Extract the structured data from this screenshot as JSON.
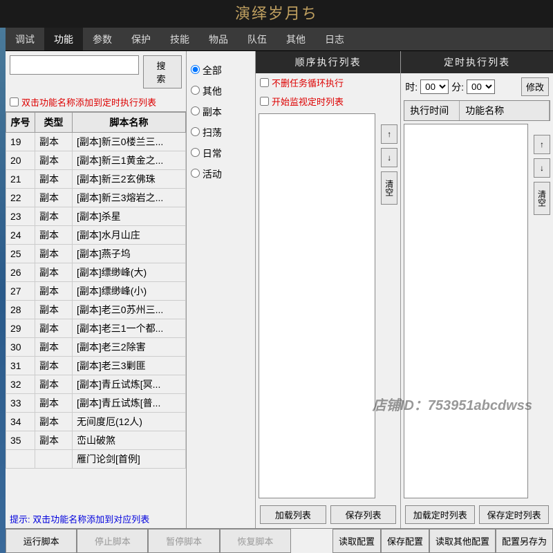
{
  "title": "演绎岁月ち",
  "menu": [
    "调试",
    "功能",
    "参数",
    "保护",
    "技能",
    "物品",
    "队伍",
    "其他",
    "日志"
  ],
  "menu_active": 1,
  "search_btn": "搜 索",
  "add_hint": "双击功能名称添加到定时执行列表",
  "table_headers": [
    "序号",
    "类型",
    "脚本名称"
  ],
  "scripts": [
    {
      "n": "19",
      "t": "副本",
      "name": "[副本]新三0楼兰三..."
    },
    {
      "n": "20",
      "t": "副本",
      "name": "[副本]新三1黄金之..."
    },
    {
      "n": "21",
      "t": "副本",
      "name": "[副本]新三2玄佛珠"
    },
    {
      "n": "22",
      "t": "副本",
      "name": "[副本]新三3熔岩之..."
    },
    {
      "n": "23",
      "t": "副本",
      "name": "[副本]杀星"
    },
    {
      "n": "24",
      "t": "副本",
      "name": "[副本]水月山庄"
    },
    {
      "n": "25",
      "t": "副本",
      "name": "[副本]燕子坞"
    },
    {
      "n": "26",
      "t": "副本",
      "name": "[副本]缥缈峰(大)"
    },
    {
      "n": "27",
      "t": "副本",
      "name": "[副本]缥缈峰(小)"
    },
    {
      "n": "28",
      "t": "副本",
      "name": "[副本]老三0苏州三..."
    },
    {
      "n": "29",
      "t": "副本",
      "name": "[副本]老三1一个都..."
    },
    {
      "n": "30",
      "t": "副本",
      "name": "[副本]老三2除害"
    },
    {
      "n": "31",
      "t": "副本",
      "name": "[副本]老三3剿匪"
    },
    {
      "n": "32",
      "t": "副本",
      "name": "[副本]青丘试炼[冥..."
    },
    {
      "n": "33",
      "t": "副本",
      "name": "[副本]青丘试炼[普..."
    },
    {
      "n": "34",
      "t": "副本",
      "name": "无间度厄(12人)"
    },
    {
      "n": "35",
      "t": "副本",
      "name": "峦山破煞"
    },
    {
      "n": "",
      "t": "",
      "name": "雁门论剑[首例]"
    }
  ],
  "tip": "提示: 双击功能名称添加到对应列表",
  "filters": [
    "全部",
    "其他",
    "副本",
    "扫荡",
    "日常",
    "活动"
  ],
  "seq_header": "顺序执行列表",
  "timer_header": "定时执行列表",
  "chk_loop": "不删任务循环执行",
  "chk_monitor": "开始监视定时列表",
  "hour_lbl": "时:",
  "minute_lbl": "分:",
  "time_val": "00",
  "modify_btn": "修改",
  "timer_cols": [
    "执行时间",
    "功能名称"
  ],
  "up_btn": "↑",
  "down_btn": "↓",
  "clear_btn": "清空",
  "load_list": "加载列表",
  "save_list": "保存列表",
  "load_timer": "加载定时列表",
  "save_timer": "保存定时列表",
  "bottom": [
    "运行脚本",
    "停止脚本",
    "暂停脚本",
    "恢复脚本",
    "读取配置",
    "保存配置",
    "读取其他配置",
    "配置另存为"
  ],
  "watermark": "店铺ID：753951abcdwss"
}
